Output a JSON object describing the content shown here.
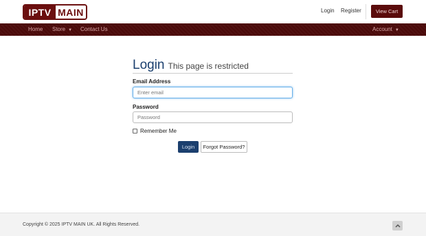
{
  "header": {
    "logo_left": "IPTV",
    "logo_right": "MAIN",
    "login_link": "Login",
    "register_link": "Register",
    "view_cart": "View Cart"
  },
  "nav": {
    "home": "Home",
    "store": "Store",
    "contact": "Contact Us",
    "account": "Account"
  },
  "main": {
    "title": "Login",
    "subtitle": "This page is restricted",
    "email_label": "Email Address",
    "email_placeholder": "Enter email",
    "password_label": "Password",
    "password_placeholder": "Password",
    "remember_label": "Remember Me",
    "login_button": "Login",
    "forgot_button": "Forgot Password?"
  },
  "footer": {
    "copyright": "Copyright © 2025 IPTV MAIN UK. All Rights Reserved."
  },
  "colors": {
    "brand": "#6b0f0f",
    "nav_bg": "#4a0909",
    "primary": "#1b3f6e"
  },
  "icons": {
    "caret": "chevron-down-icon",
    "back_to_top": "chevron-up-icon"
  }
}
